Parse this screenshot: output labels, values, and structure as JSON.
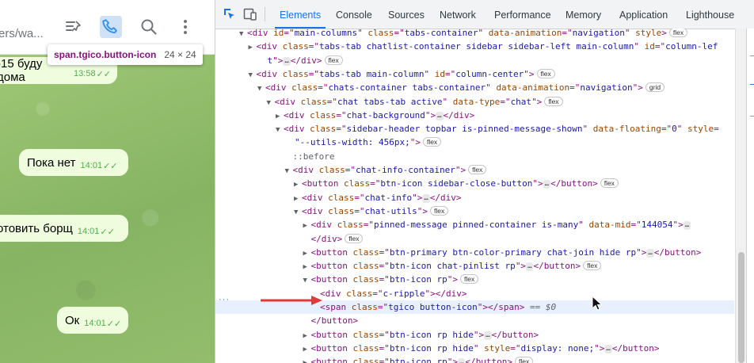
{
  "chat": {
    "header_title": "ers/wa...",
    "icons": [
      "pin-list-icon",
      "phone-icon",
      "search-icon",
      "more-vertical-icon"
    ],
    "tooltip": {
      "selector": "span.tgico.button-icon",
      "size": "24 × 24"
    },
    "messages": [
      {
        "text": "-15 буду дома",
        "time": "13:58"
      },
      {
        "text": "Пока нет",
        "time": "14:01"
      },
      {
        "text": "отовить борщ",
        "time": "14:01"
      },
      {
        "text": "Ок",
        "time": "14:01"
      }
    ]
  },
  "devtools": {
    "tabs": [
      "Elements",
      "Console",
      "Sources",
      "Network",
      "Performance",
      "Memory",
      "Application",
      "Lighthouse"
    ],
    "active_tab": "Elements",
    "tree": [
      {
        "d": 0,
        "t": "open",
        "h": [
          [
            "tag",
            "<div "
          ],
          [
            "an",
            "id"
          ],
          [
            "tag",
            "=\""
          ],
          [
            "av",
            "main-columns"
          ],
          [
            "tag",
            "\" "
          ],
          [
            "an",
            "class"
          ],
          [
            "tag",
            "=\""
          ],
          [
            "av",
            "tabs-container"
          ],
          [
            "tag",
            "\" "
          ],
          [
            "an",
            "data-animation"
          ],
          [
            "tag",
            "=\""
          ],
          [
            "av",
            "navigation"
          ],
          [
            "tag",
            "\" "
          ],
          [
            "an",
            "style"
          ],
          [
            "tag",
            ">"
          ]
        ],
        "badge": "flex"
      },
      {
        "d": 1,
        "t": "closed",
        "h": [
          [
            "tag",
            "<div "
          ],
          [
            "an",
            "class"
          ],
          [
            "tag",
            "=\""
          ],
          [
            "av",
            "tabs-tab chatlist-container sidebar sidebar-left main-column"
          ],
          [
            "tag",
            "\" "
          ],
          [
            "an",
            "id"
          ],
          [
            "tag",
            "=\""
          ],
          [
            "av",
            "column-lef"
          ]
        ]
      },
      {
        "d": 1,
        "t": "none",
        "h": [
          [
            "av",
            "t"
          ],
          [
            "tag",
            "\">"
          ],
          [
            "ell",
            "…"
          ],
          [
            "tag",
            "</div>"
          ]
        ],
        "badge": "flex",
        "indent": 2
      },
      {
        "d": 1,
        "t": "open",
        "h": [
          [
            "tag",
            "<div "
          ],
          [
            "an",
            "class"
          ],
          [
            "tag",
            "=\""
          ],
          [
            "av",
            "tabs-tab main-column"
          ],
          [
            "tag",
            "\" "
          ],
          [
            "an",
            "id"
          ],
          [
            "tag",
            "=\""
          ],
          [
            "av",
            "column-center"
          ],
          [
            "tag",
            "\">"
          ]
        ],
        "badge": "flex"
      },
      {
        "d": 2,
        "t": "open",
        "h": [
          [
            "tag",
            "<div "
          ],
          [
            "an",
            "class"
          ],
          [
            "tag",
            "=\""
          ],
          [
            "av",
            "chats-container tabs-container"
          ],
          [
            "tag",
            "\" "
          ],
          [
            "an",
            "data-animation"
          ],
          [
            "tag",
            "=\""
          ],
          [
            "av",
            "navigation"
          ],
          [
            "tag",
            "\">"
          ]
        ],
        "badge": "grid"
      },
      {
        "d": 3,
        "t": "open",
        "h": [
          [
            "tag",
            "<div "
          ],
          [
            "an",
            "class"
          ],
          [
            "tag",
            "=\""
          ],
          [
            "av",
            "chat tabs-tab active"
          ],
          [
            "tag",
            "\" "
          ],
          [
            "an",
            "data-type"
          ],
          [
            "tag",
            "=\""
          ],
          [
            "av",
            "chat"
          ],
          [
            "tag",
            "\">"
          ]
        ],
        "badge": "flex"
      },
      {
        "d": 4,
        "t": "closed",
        "h": [
          [
            "tag",
            "<div "
          ],
          [
            "an",
            "class"
          ],
          [
            "tag",
            "=\""
          ],
          [
            "av",
            "chat-background"
          ],
          [
            "tag",
            "\">"
          ],
          [
            "ell",
            "…"
          ],
          [
            "tag",
            "</div>"
          ]
        ]
      },
      {
        "d": 4,
        "t": "open",
        "h": [
          [
            "tag",
            "<div "
          ],
          [
            "an",
            "class"
          ],
          [
            "tag",
            "=\""
          ],
          [
            "av",
            "sidebar-header topbar is-pinned-message-shown"
          ],
          [
            "tag",
            "\" "
          ],
          [
            "an",
            "data-floating"
          ],
          [
            "tag",
            "=\""
          ],
          [
            "av",
            "0"
          ],
          [
            "tag",
            "\" "
          ],
          [
            "an",
            "style"
          ],
          [
            "tag",
            "="
          ]
        ]
      },
      {
        "d": 4,
        "t": "none",
        "h": [
          [
            "av",
            "\"--utils-width: 456px;"
          ],
          [
            "tag",
            "\">"
          ]
        ],
        "badge": "flex",
        "indent": 2
      },
      {
        "d": 5,
        "t": "none",
        "h": [
          [
            "pseudo",
            "::before"
          ]
        ]
      },
      {
        "d": 5,
        "t": "open",
        "h": [
          [
            "tag",
            "<div "
          ],
          [
            "an",
            "class"
          ],
          [
            "tag",
            "=\""
          ],
          [
            "av",
            "chat-info-container"
          ],
          [
            "tag",
            "\">"
          ]
        ],
        "badge": "flex"
      },
      {
        "d": 6,
        "t": "closed",
        "h": [
          [
            "tag",
            "<button "
          ],
          [
            "an",
            "class"
          ],
          [
            "tag",
            "=\""
          ],
          [
            "av",
            "btn-icon sidebar-close-button"
          ],
          [
            "tag",
            "\">"
          ],
          [
            "ell",
            "…"
          ],
          [
            "tag",
            "</button>"
          ]
        ],
        "badge": "flex"
      },
      {
        "d": 6,
        "t": "closed",
        "h": [
          [
            "tag",
            "<div "
          ],
          [
            "an",
            "class"
          ],
          [
            "tag",
            "=\""
          ],
          [
            "av",
            "chat-info"
          ],
          [
            "tag",
            "\">"
          ],
          [
            "ell",
            "…"
          ],
          [
            "tag",
            "</div>"
          ]
        ]
      },
      {
        "d": 6,
        "t": "open",
        "h": [
          [
            "tag",
            "<div "
          ],
          [
            "an",
            "class"
          ],
          [
            "tag",
            "=\""
          ],
          [
            "av",
            "chat-utils"
          ],
          [
            "tag",
            "\">"
          ]
        ],
        "badge": "flex"
      },
      {
        "d": 7,
        "t": "closed",
        "h": [
          [
            "tag",
            "<div "
          ],
          [
            "an",
            "class"
          ],
          [
            "tag",
            "=\""
          ],
          [
            "av",
            "pinned-message pinned-container is-many"
          ],
          [
            "tag",
            "\" "
          ],
          [
            "an",
            "data-mid"
          ],
          [
            "tag",
            "=\""
          ],
          [
            "av",
            "144054"
          ],
          [
            "tag",
            "\">"
          ],
          [
            "ell",
            "…"
          ]
        ]
      },
      {
        "d": 7,
        "t": "none",
        "h": [
          [
            "tag",
            "</div>"
          ]
        ],
        "badge": "flex"
      },
      {
        "d": 7,
        "t": "closed",
        "h": [
          [
            "tag",
            "<button "
          ],
          [
            "an",
            "class"
          ],
          [
            "tag",
            "=\""
          ],
          [
            "av",
            "btn-primary btn-color-primary chat-join hide rp"
          ],
          [
            "tag",
            "\">"
          ],
          [
            "ell",
            "…"
          ],
          [
            "tag",
            "</button>"
          ]
        ]
      },
      {
        "d": 7,
        "t": "closed",
        "h": [
          [
            "tag",
            "<button "
          ],
          [
            "an",
            "class"
          ],
          [
            "tag",
            "=\""
          ],
          [
            "av",
            "btn-icon chat-pinlist rp"
          ],
          [
            "tag",
            "\">"
          ],
          [
            "ell",
            "…"
          ],
          [
            "tag",
            "</button>"
          ]
        ],
        "badge": "flex"
      },
      {
        "d": 7,
        "t": "open",
        "h": [
          [
            "tag",
            "<button "
          ],
          [
            "an",
            "class"
          ],
          [
            "tag",
            "=\""
          ],
          [
            "av",
            "btn-icon rp"
          ],
          [
            "tag",
            "\">"
          ]
        ],
        "badge": "flex"
      },
      {
        "d": 8,
        "t": "none",
        "h": [
          [
            "tag",
            "<div "
          ],
          [
            "an",
            "class"
          ],
          [
            "tag",
            "=\""
          ],
          [
            "av",
            "c-ripple"
          ],
          [
            "tag",
            "\"></div>"
          ]
        ]
      },
      {
        "d": 8,
        "t": "none",
        "sel": true,
        "h": [
          [
            "tag",
            "<span "
          ],
          [
            "an",
            "class"
          ],
          [
            "tag",
            "=\""
          ],
          [
            "av",
            "tgico button-icon"
          ],
          [
            "tag",
            "\">"
          ],
          [
            "txt",
            ""
          ],
          [
            "tag",
            "</span>"
          ],
          [
            "eq",
            " == $0"
          ]
        ]
      },
      {
        "d": 7,
        "t": "none",
        "h": [
          [
            "tag",
            "</button>"
          ]
        ]
      },
      {
        "d": 7,
        "t": "closed",
        "h": [
          [
            "tag",
            "<button "
          ],
          [
            "an",
            "class"
          ],
          [
            "tag",
            "=\""
          ],
          [
            "av",
            "btn-icon rp hide"
          ],
          [
            "tag",
            "\">"
          ],
          [
            "ell",
            "…"
          ],
          [
            "tag",
            "</button>"
          ]
        ]
      },
      {
        "d": 7,
        "t": "closed",
        "h": [
          [
            "tag",
            "<button "
          ],
          [
            "an",
            "class"
          ],
          [
            "tag",
            "=\""
          ],
          [
            "av",
            "btn-icon rp hide"
          ],
          [
            "tag",
            "\" "
          ],
          [
            "an",
            "style"
          ],
          [
            "tag",
            "=\""
          ],
          [
            "av",
            "display: none;"
          ],
          [
            "tag",
            "\">"
          ],
          [
            "ell",
            "…"
          ],
          [
            "tag",
            "</button>"
          ]
        ]
      },
      {
        "d": 7,
        "t": "closed",
        "h": [
          [
            "tag",
            "<button "
          ],
          [
            "an",
            "class"
          ],
          [
            "tag",
            "=\""
          ],
          [
            "av",
            "btn-icon rp"
          ],
          [
            "tag",
            "\">"
          ],
          [
            "ell",
            "…"
          ],
          [
            "tag",
            "</button>"
          ]
        ],
        "badge": "flex"
      }
    ],
    "gutter_dots": "···",
    "colors": {
      "accent": "#1a73e8",
      "tag": "#881280",
      "attr_name": "#994500",
      "attr_value": "#1a1aa6",
      "arrow": "#e03a3a"
    }
  }
}
